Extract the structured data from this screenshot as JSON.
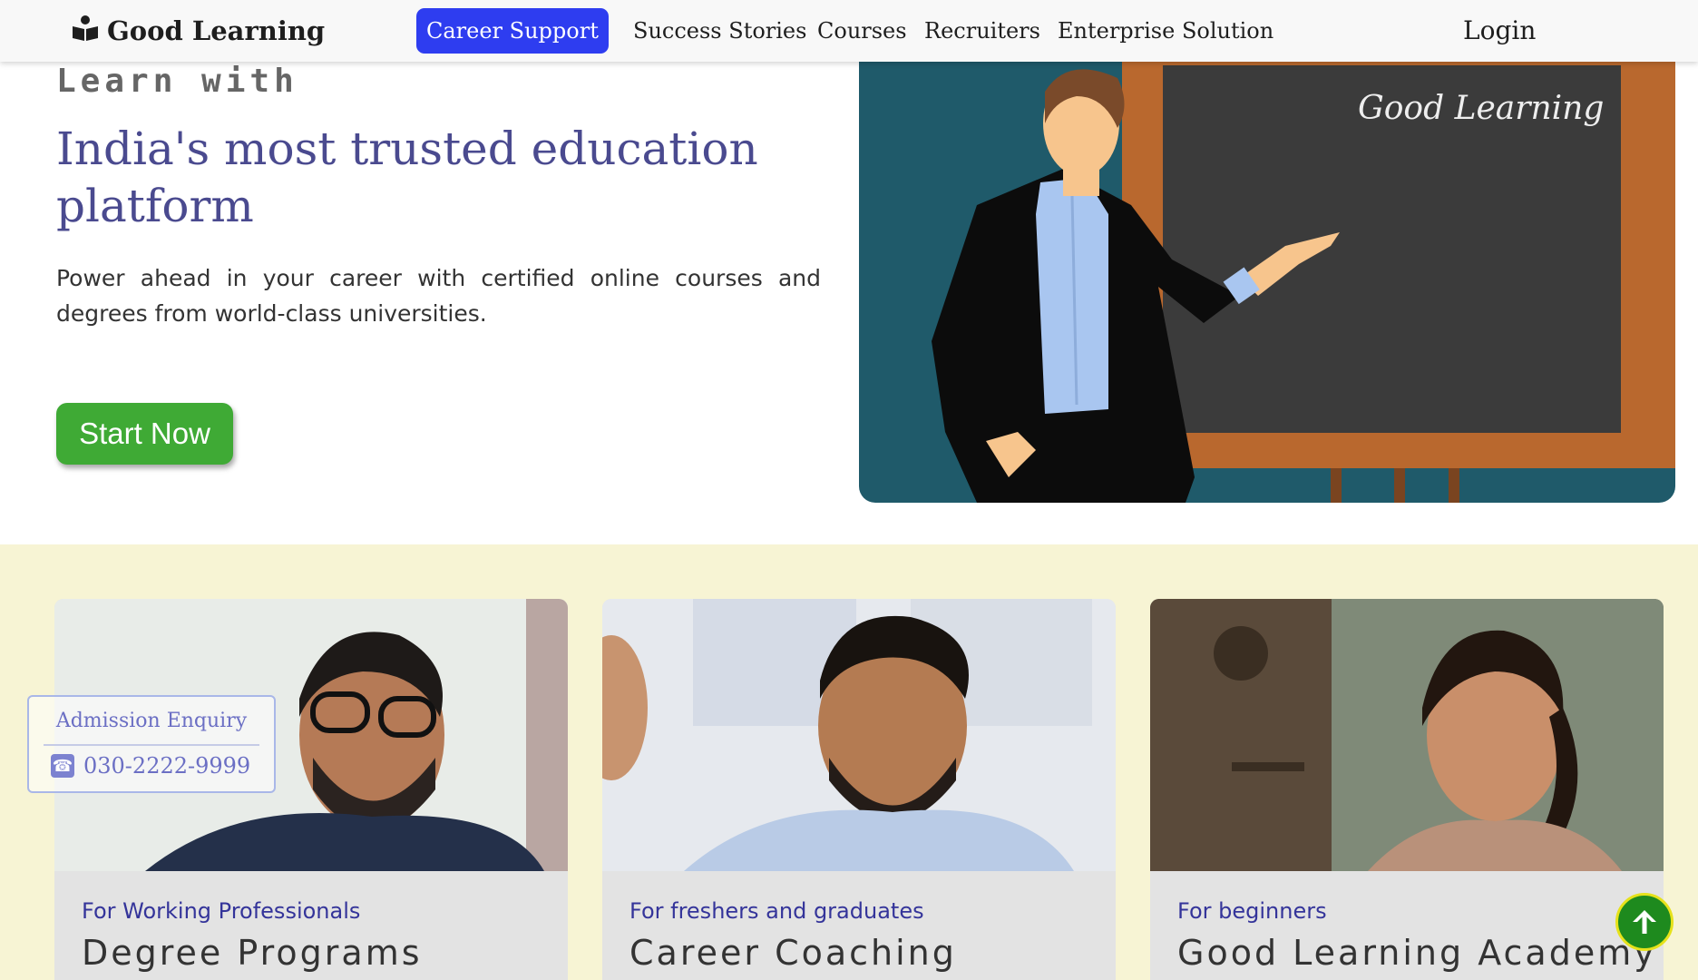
{
  "nav": {
    "brand": "Good Learning",
    "items": [
      {
        "label": "Career Support",
        "active": true
      },
      {
        "label": "Success Stories"
      },
      {
        "label": "Courses"
      },
      {
        "label": "Recruiters"
      },
      {
        "label": "Enterprise Solution"
      }
    ],
    "login": "Login"
  },
  "hero": {
    "eyebrow": "Learn with",
    "title": "India's most trusted education platform",
    "subtitle": "Power ahead in your career with certified online courses and degrees from world-class universities.",
    "cta": "Start Now",
    "board_text": "Good Learning"
  },
  "cards": [
    {
      "tag": "For Working Professionals",
      "title": "Degree Programs"
    },
    {
      "tag": "For freshers and graduates",
      "title": "Career Coaching"
    },
    {
      "tag": "For beginners",
      "title": "Good Learning Academy"
    }
  ],
  "enquiry": {
    "title": "Admission Enquiry",
    "phone": "030-2222-9999"
  },
  "colors": {
    "accent": "#2e3df0",
    "cta": "#3faa35",
    "title": "#4a4a8f",
    "section_bg": "#f7f4d4"
  }
}
